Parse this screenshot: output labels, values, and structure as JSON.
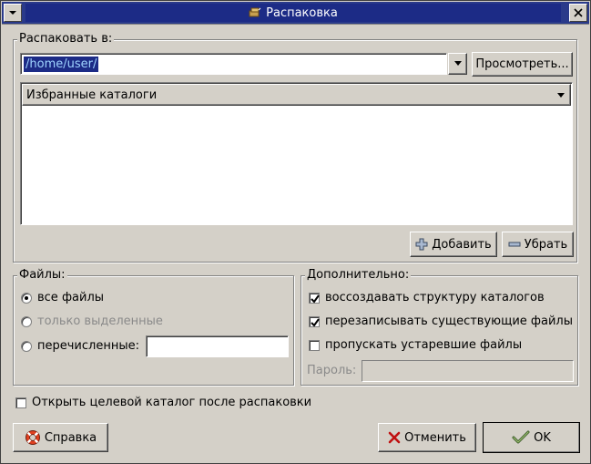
{
  "window": {
    "title": "Распаковка"
  },
  "extract_to": {
    "label": "Распаковать в:",
    "path": "/home/user/",
    "browse_label": "Просмотреть..."
  },
  "favorites": {
    "header": "Избранные каталоги",
    "add_label": "Добавить",
    "remove_label": "Убрать"
  },
  "files": {
    "label": "Файлы:",
    "all_files": "все файлы",
    "selected_only": "только выделенные",
    "listed": "перечисленные:",
    "listed_value": ""
  },
  "extra": {
    "label": "Дополнительно:",
    "recreate_dirs": "воссоздавать структуру каталогов",
    "overwrite": "перезаписывать существующие файлы",
    "skip_older": "пропускать устаревшие файлы",
    "password_label": "Пароль:",
    "password_value": ""
  },
  "open_after": "Открыть целевой каталог после распаковки",
  "buttons": {
    "help": "Справка",
    "cancel": "Отменить",
    "ok": "OK"
  },
  "icons": {
    "menu": "chevron-down-icon",
    "close": "close-icon",
    "app": "archive-icon",
    "add": "plus-icon",
    "remove": "minus-icon",
    "help": "lifebuoy-icon",
    "cancel": "x-icon",
    "ok": "check-icon"
  },
  "colors": {
    "titlebar": "#1c2b86",
    "selection": "#1c2b86",
    "face": "#d4d0c8"
  }
}
